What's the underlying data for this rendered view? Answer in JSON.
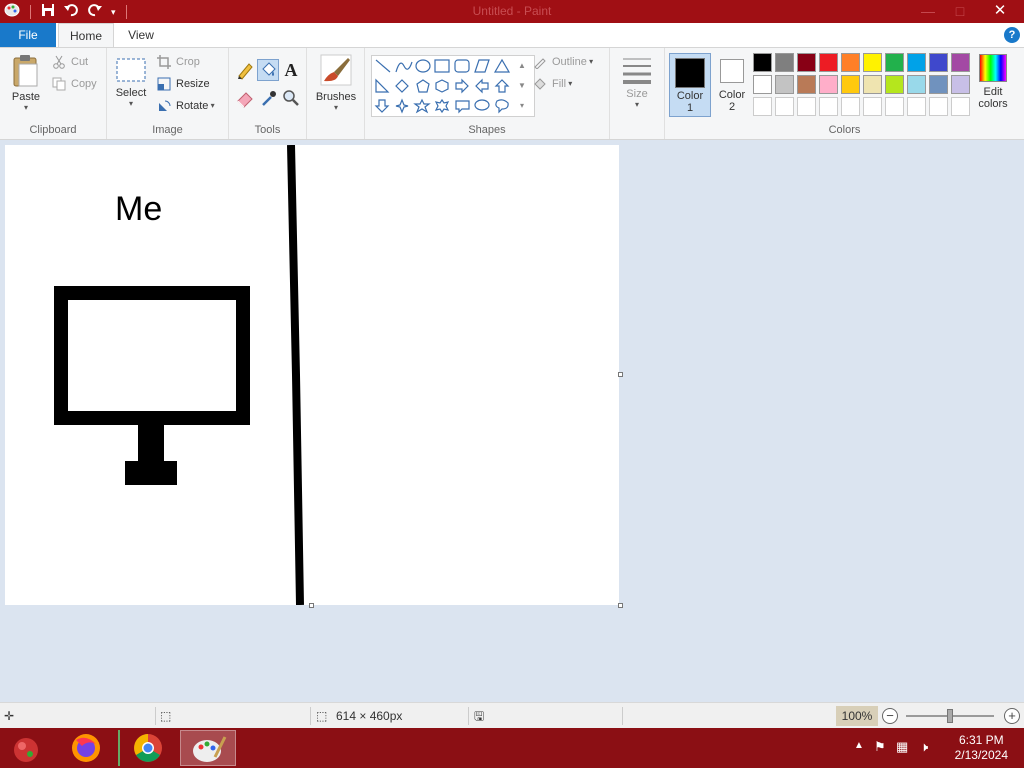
{
  "window": {
    "title": "Untitled - Paint",
    "minimize_glyph": "—",
    "maximize_glyph": "□",
    "close_glyph": "✕"
  },
  "quick_access": {
    "icons": [
      "paint-app-icon",
      "save-icon",
      "undo-icon",
      "redo-icon",
      "customize-dropdown-icon"
    ]
  },
  "tabs": {
    "file": "File",
    "home": "Home",
    "view": "View",
    "help": "?"
  },
  "ribbon": {
    "clipboard": {
      "label": "Clipboard",
      "paste": "Paste",
      "cut": "Cut",
      "copy": "Copy"
    },
    "image": {
      "label": "Image",
      "select": "Select",
      "crop": "Crop",
      "resize": "Resize",
      "rotate": "Rotate"
    },
    "tools": {
      "label": "Tools",
      "text_tool": "A"
    },
    "brushes": {
      "label": "Brushes"
    },
    "shapes": {
      "label": "Shapes",
      "outline": "Outline",
      "fill": "Fill"
    },
    "size": {
      "label": "Size"
    },
    "colors": {
      "label": "Colors",
      "color1": "Color",
      "color1_num": "1",
      "color2": "Color",
      "color2_num": "2",
      "edit": "Edit",
      "edit2": "colors",
      "color1_value": "#000000",
      "color2_value": "#ffffff",
      "palette_row1": [
        "#000000",
        "#7f7f7f",
        "#880015",
        "#ed1c24",
        "#ff7f27",
        "#fff200",
        "#22b14c",
        "#00a2e8",
        "#3f48cc",
        "#a349a4"
      ],
      "palette_row2": [
        "#ffffff",
        "#c3c3c3",
        "#b97a57",
        "#ffaec9",
        "#ffc90e",
        "#efe4b0",
        "#b5e61d",
        "#99d9ea",
        "#7092be",
        "#c8bfe7"
      ],
      "palette_row3": [
        "#ffffff",
        "#ffffff",
        "#ffffff",
        "#ffffff",
        "#ffffff",
        "#ffffff",
        "#ffffff",
        "#ffffff",
        "#ffffff",
        "#ffffff"
      ]
    }
  },
  "canvas": {
    "text": "Me"
  },
  "status": {
    "dimensions": "614 × 460px",
    "zoom": "100%"
  },
  "taskbar": {
    "apps": [
      "paint-splash-icon",
      "firefox-icon",
      "chrome-icon",
      "paint-icon"
    ],
    "time": "6:31 PM",
    "date": "2/13/2024"
  }
}
